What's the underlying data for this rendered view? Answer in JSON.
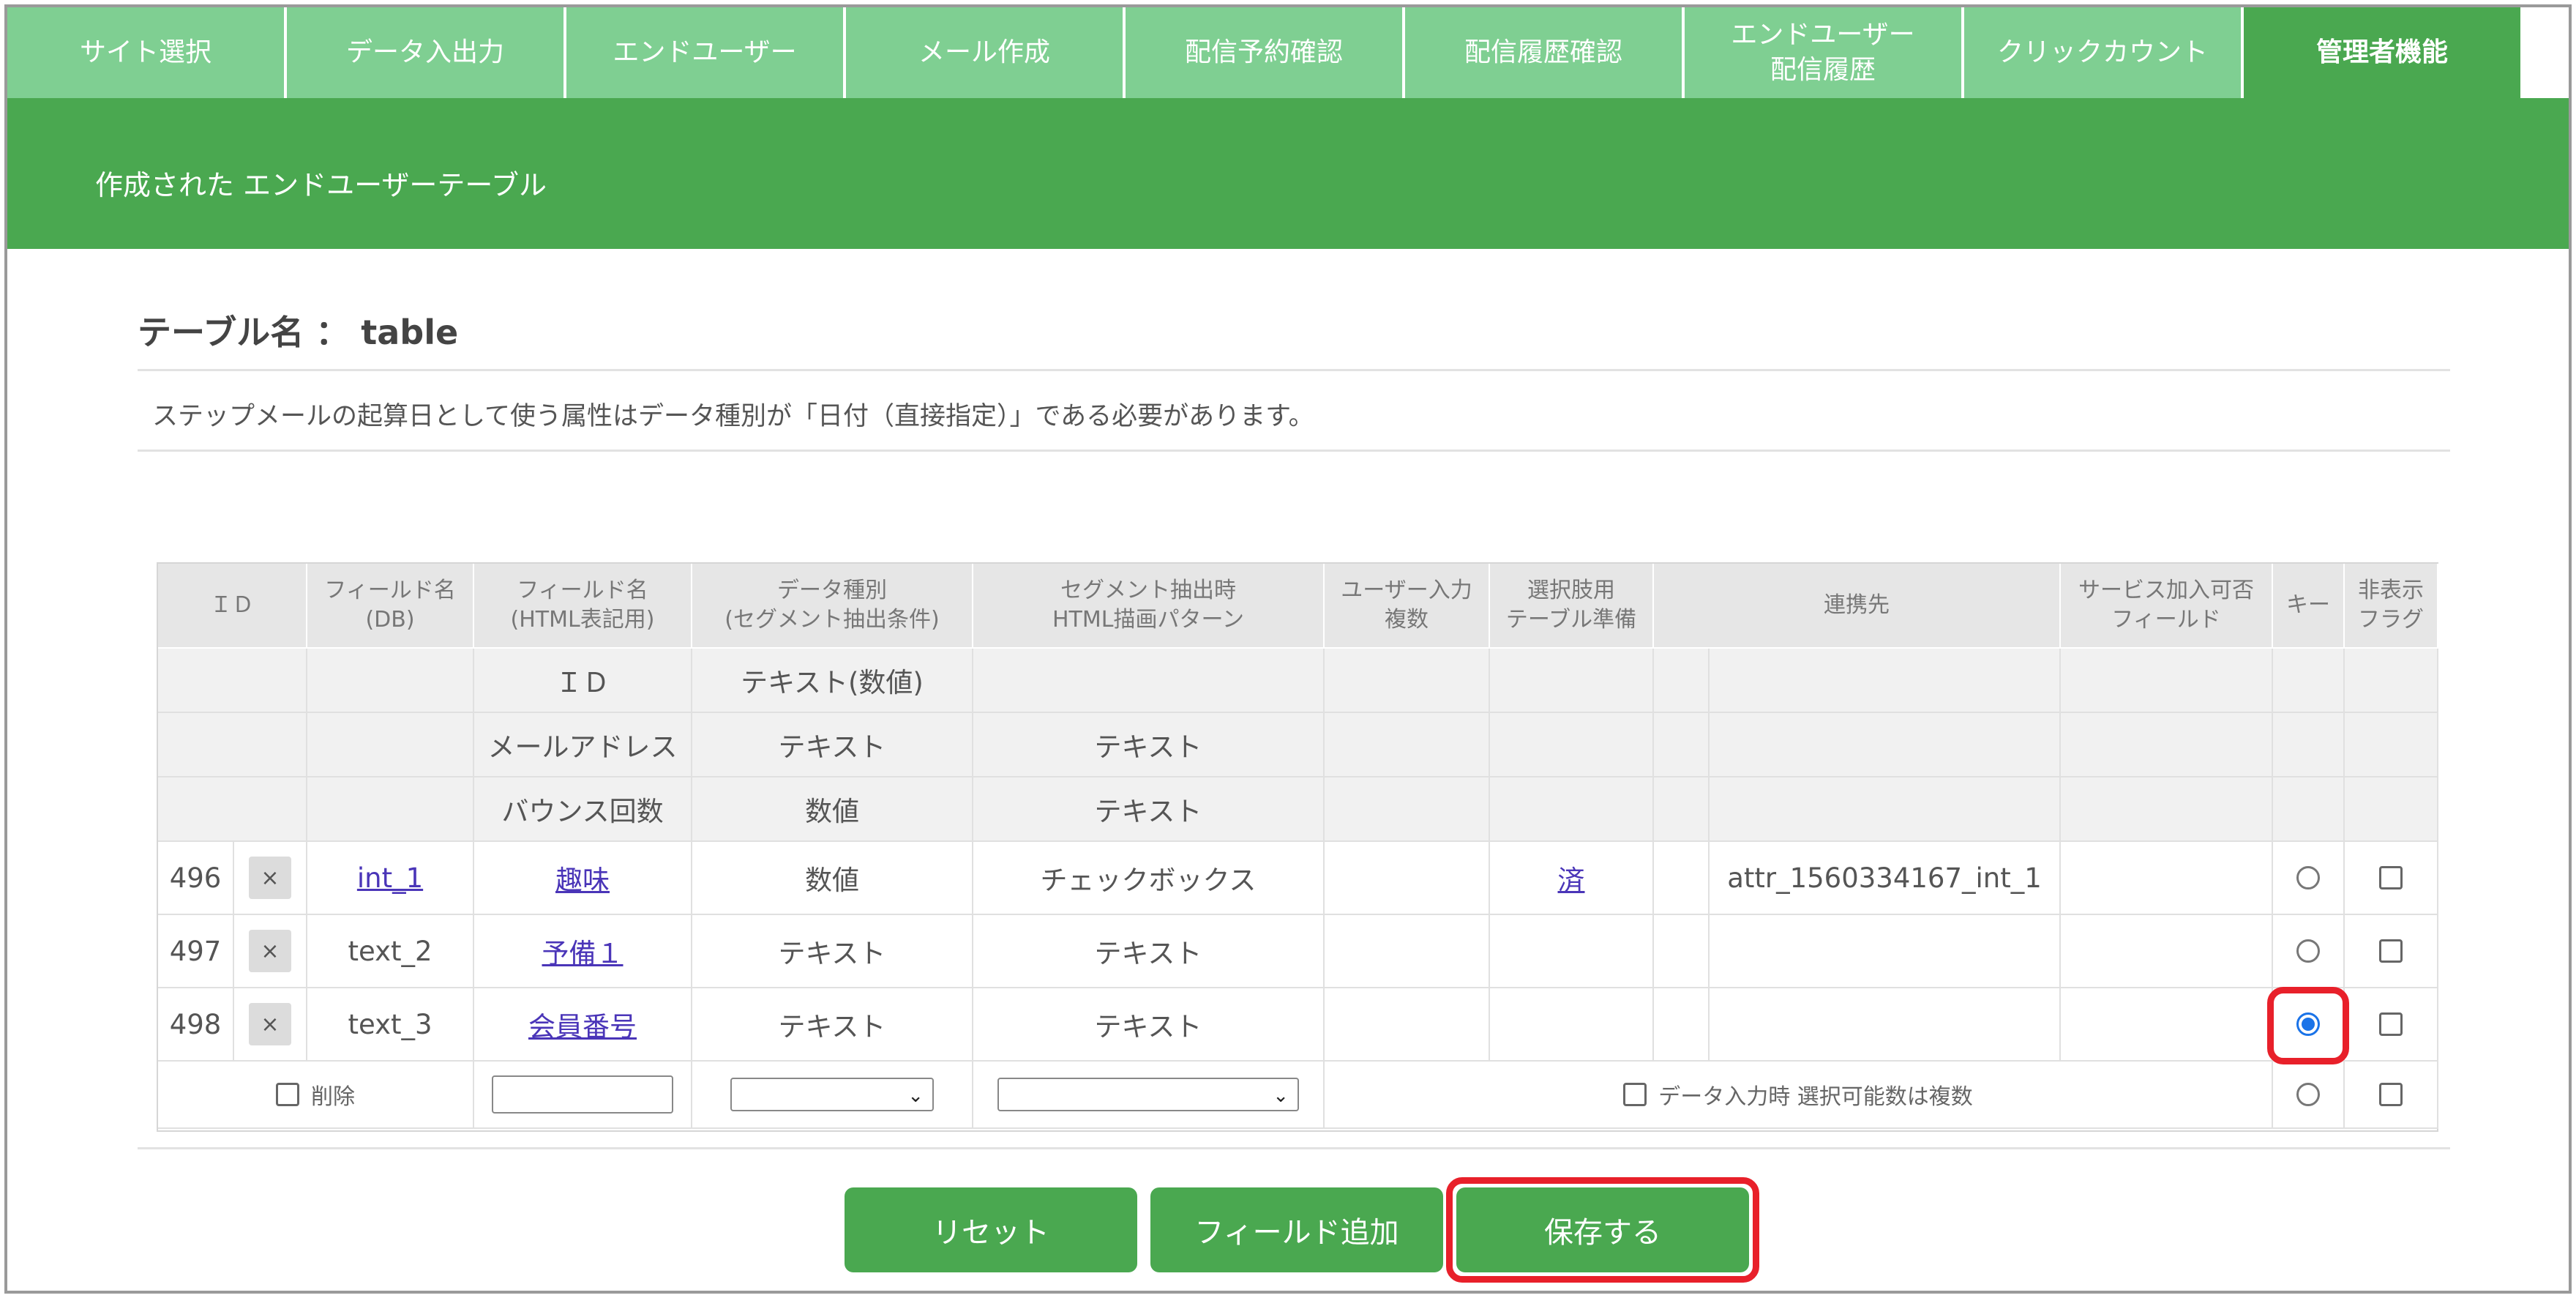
{
  "nav": {
    "tabs": [
      {
        "label": "サイト選択"
      },
      {
        "label": "データ入出力"
      },
      {
        "label": "エンドユーザー"
      },
      {
        "label": "メール作成"
      },
      {
        "label": "配信予約確認"
      },
      {
        "label": "配信履歴確認"
      },
      {
        "label": "エンドユーザー\n配信履歴"
      },
      {
        "label": "クリックカウント"
      },
      {
        "label": "管理者機能"
      }
    ],
    "active_index": 8
  },
  "banner": {
    "title": "作成された エンドユーザーテーブル"
  },
  "table_name": "テーブル名 ： table",
  "note": "ステップメールの起算日として使う属性はデータ種別が「日付（直接指定）」である必要があります。",
  "headers": {
    "id": "ＩＤ",
    "field_db": "フィールド名\n(DB)",
    "field_html": "フィールド名\n(HTML表記用)",
    "data_type": "データ種別\n(セグメント抽出条件)",
    "segment": "セグメント抽出時\nHTML描画パターン",
    "user_input": "ユーザー入力\n複数",
    "choice": "選択肢用\nテーブル準備",
    "link": "連携先",
    "service": "サービス加入可否\nフィールド",
    "key": "キー",
    "hidden": "非表示\nフラグ"
  },
  "fixed_rows": [
    {
      "html_name": "ＩＤ",
      "data_type": "テキスト(数値)",
      "segment": ""
    },
    {
      "html_name": "メールアドレス",
      "data_type": "テキスト",
      "segment": "テキスト"
    },
    {
      "html_name": "バウンス回数",
      "data_type": "数値",
      "segment": "テキスト"
    }
  ],
  "rows": [
    {
      "id": "496",
      "delete": "×",
      "db_name": "int_1",
      "db_link": true,
      "html_name": "趣味",
      "data_type": "数値",
      "segment": "チェックボックス",
      "choice": "済",
      "link": "attr_1560334167_int_1",
      "key_selected": false
    },
    {
      "id": "497",
      "delete": "×",
      "db_name": "text_2",
      "db_link": false,
      "html_name": "予備１",
      "data_type": "テキスト",
      "segment": "テキスト",
      "choice": "",
      "link": "",
      "key_selected": false
    },
    {
      "id": "498",
      "delete": "×",
      "db_name": "text_3",
      "db_link": false,
      "html_name": "会員番号",
      "data_type": "テキスト",
      "segment": "テキスト",
      "choice": "",
      "link": "",
      "key_selected": true
    }
  ],
  "new_row": {
    "delete_label": "削除",
    "multi_label": "データ入力時 選択可能数は複数"
  },
  "buttons": {
    "reset": "リセット",
    "add_field": "フィールド追加",
    "save": "保存する"
  },
  "colors": {
    "nav_tab": "#7fcf92",
    "nav_active": "#4aa850",
    "banner": "#4aa850",
    "button": "#4aa850",
    "highlight": "#e8202a",
    "link": "#4a35b8",
    "radio_on": "#1a73e8"
  }
}
